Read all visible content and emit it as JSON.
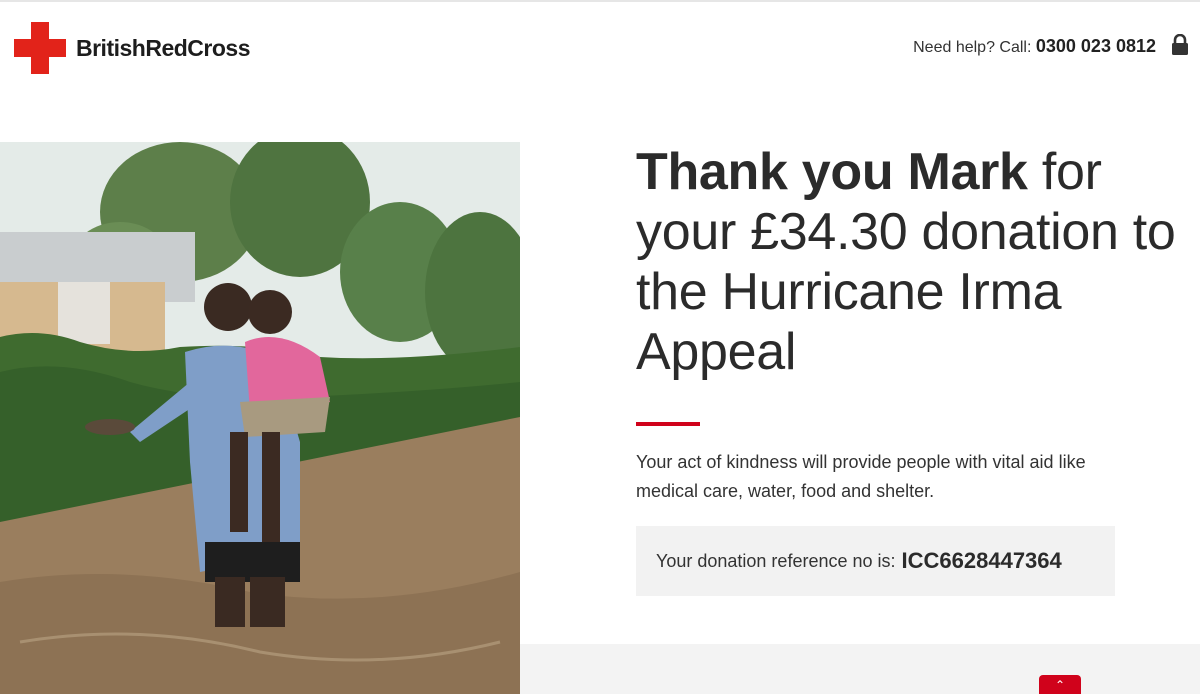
{
  "brand": {
    "logo_text": "BritishRedCross",
    "accent": "#d0021b"
  },
  "header": {
    "help_prefix": "Need help? Call: ",
    "phone": "0300 023 0812",
    "lock_icon": "lock-icon"
  },
  "thank_you": {
    "bold_part": "Thank you Mark",
    "rest": " for your £34.30 donation to the Hurricane Irma Appeal"
  },
  "message": "Your act of kindness will provide people with vital aid like medical care, water, food and shelter.",
  "reference": {
    "label": "Your donation reference no is:",
    "value": "ICC6628447364"
  },
  "footer": {
    "back_to_top_icon": "chevron-up-icon",
    "back_to_top_glyph": "⌃"
  }
}
